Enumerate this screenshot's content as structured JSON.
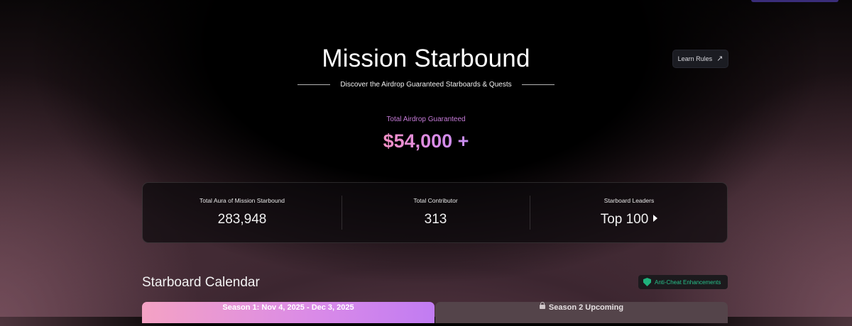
{
  "header": {
    "title": "Mission Starbound",
    "subtitle": "Discover the Airdrop Guaranteed Starboards & Quests",
    "learn_rules_label": "Learn Rules",
    "learn_rules_icon": "↗"
  },
  "airdrop": {
    "label": "Total Airdrop Guaranteed",
    "value": "$54,000 +"
  },
  "stats": {
    "aura": {
      "label": "Total Aura of Mission Starbound",
      "value": "283,948"
    },
    "contributors": {
      "label": "Total Contributor",
      "value": "313"
    },
    "leaders": {
      "label": "Starboard Leaders",
      "value": "Top 100"
    }
  },
  "calendar": {
    "title": "Starboard Calendar",
    "badge": "Anti-Cheat Enhancements",
    "tabs": [
      {
        "label": "Season 1: Nov 4, 2025 - Dec 3, 2025"
      },
      {
        "label": "Season 2 Upcoming"
      }
    ]
  },
  "colors": {
    "accent_pink": "#f28fc4",
    "accent_purple": "#c68cf0",
    "badge_green": "#27c08a"
  }
}
